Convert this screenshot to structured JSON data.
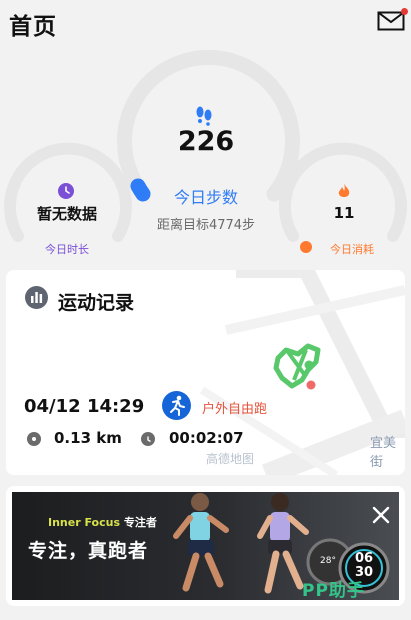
{
  "header": {
    "title": "首页",
    "mail_icon": "mail-icon",
    "has_notification": true
  },
  "rings": {
    "left": {
      "value": "暂无数据",
      "label": "今日时长",
      "icon": "clock-icon",
      "color": "#7b4fd6"
    },
    "center": {
      "value": "226",
      "label": "今日步数",
      "goal_text": "距离目标4774步",
      "icon": "footprints-icon",
      "color": "#2f7df6",
      "progress": 0.045
    },
    "right": {
      "value": "11",
      "label": "今日消耗",
      "icon": "flame-icon",
      "color": "#ff7a2f"
    }
  },
  "record": {
    "title": "运动记录",
    "date": "04/12 14:29",
    "type": "户外自由跑",
    "distance": "0.13 km",
    "duration": "00:02:07",
    "map_label_right": "宜美街",
    "map_watermark": "高德地图",
    "route_color": "#58c86a"
  },
  "banner": {
    "brand": "Inner Focus",
    "brand_cn": "专注者",
    "slogan": "专注，真跑者",
    "watch_time_hour": "06",
    "watch_time_min": "30",
    "watch_small": "28°",
    "watermark": "PP助手"
  }
}
